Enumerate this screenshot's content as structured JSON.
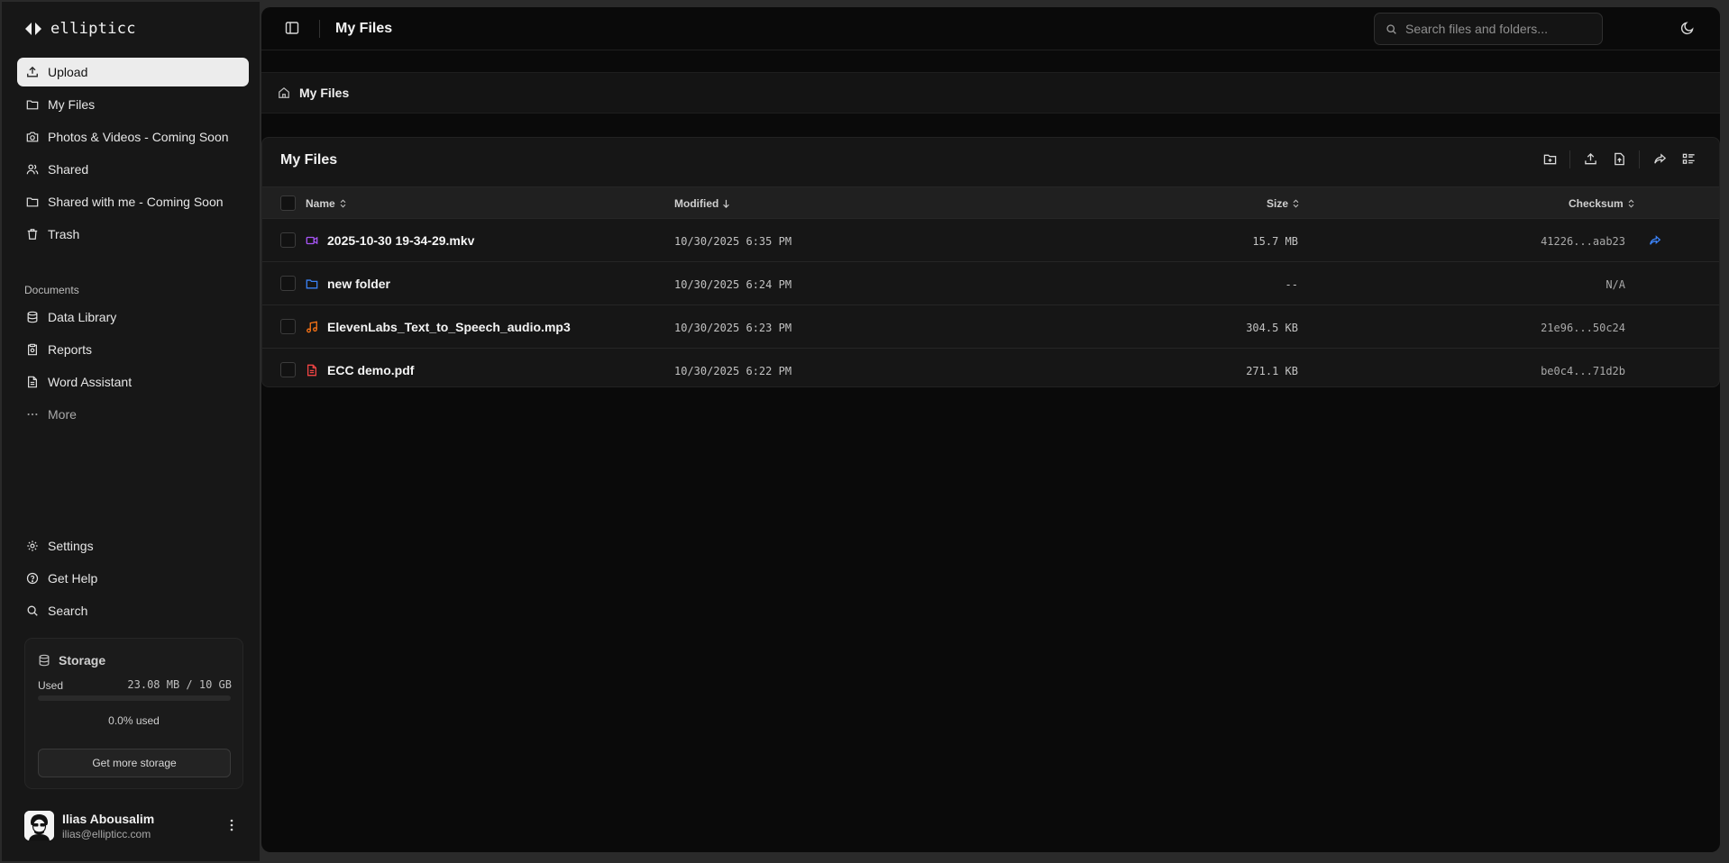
{
  "app": {
    "name": "ellipticc"
  },
  "sidebar": {
    "nav": [
      {
        "label": "Upload",
        "icon": "upload-icon"
      },
      {
        "label": "My Files",
        "icon": "folder-icon"
      },
      {
        "label": "Photos & Videos - Coming Soon",
        "icon": "camera-icon"
      },
      {
        "label": "Shared",
        "icon": "users-icon"
      },
      {
        "label": "Shared with me - Coming Soon",
        "icon": "folder-icon"
      },
      {
        "label": "Trash",
        "icon": "trash-icon"
      }
    ],
    "documents_label": "Documents",
    "documents": [
      {
        "label": "Data Library",
        "icon": "database-icon"
      },
      {
        "label": "Reports",
        "icon": "clipboard-icon"
      },
      {
        "label": "Word Assistant",
        "icon": "file-text-icon"
      },
      {
        "label": "More",
        "icon": "more-horizontal-icon"
      }
    ],
    "footer_nav": [
      {
        "label": "Settings",
        "icon": "gear-icon"
      },
      {
        "label": "Get Help",
        "icon": "help-circle-icon"
      },
      {
        "label": "Search",
        "icon": "search-icon"
      }
    ],
    "storage": {
      "title": "Storage",
      "used_label": "Used",
      "used_value": "23.08 MB / 10 GB",
      "percent_text": "0.0% used",
      "percent": 0.0,
      "button": "Get more storage"
    },
    "user": {
      "name": "Ilias Abousalim",
      "email": "ilias@ellipticc.com"
    }
  },
  "header": {
    "title": "My Files",
    "search_placeholder": "Search files and folders..."
  },
  "breadcrumb": {
    "label": "My Files"
  },
  "files_panel": {
    "title": "My Files",
    "columns": {
      "name": "Name",
      "modified": "Modified",
      "size": "Size",
      "checksum": "Checksum"
    },
    "rows": [
      {
        "name": "2025-10-30 19-34-29.mkv",
        "type": "video",
        "modified": "10/30/2025 6:35 PM",
        "size": "15.7 MB",
        "checksum": "41226...aab23",
        "shared": true
      },
      {
        "name": "new folder",
        "type": "folder",
        "modified": "10/30/2025 6:24 PM",
        "size": "--",
        "checksum": "N/A",
        "shared": false
      },
      {
        "name": "ElevenLabs_Text_to_Speech_audio.mp3",
        "type": "audio",
        "modified": "10/30/2025 6:23 PM",
        "size": "304.5 KB",
        "checksum": "21e96...50c24",
        "shared": false
      },
      {
        "name": "ECC demo.pdf",
        "type": "pdf",
        "modified": "10/30/2025 6:22 PM",
        "size": "271.1 KB",
        "checksum": "be0c4...71d2b",
        "shared": false
      }
    ]
  },
  "colors": {
    "accent_blue": "#3b82f6",
    "video": "#a855f7",
    "folder": "#3b82f6",
    "audio": "#f97316",
    "pdf": "#ef4444"
  }
}
